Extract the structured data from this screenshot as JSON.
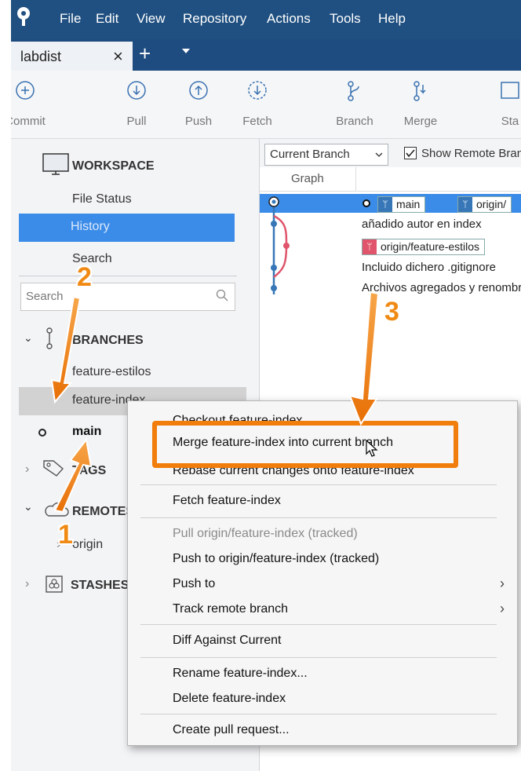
{
  "menubar": {
    "items": [
      "File",
      "Edit",
      "View",
      "Repository",
      "Actions",
      "Tools",
      "Help"
    ]
  },
  "tabs": {
    "active_label": "labdist",
    "close_glyph": "×",
    "add_glyph": "+"
  },
  "toolbar": {
    "commit": "Commit",
    "pull": "Pull",
    "push": "Push",
    "fetch": "Fetch",
    "branch": "Branch",
    "merge": "Merge",
    "stash": "Sta"
  },
  "sidebar": {
    "workspace_title": "WORKSPACE",
    "file_status": "File Status",
    "history": "History",
    "search_item": "Search",
    "search_placeholder": "Search",
    "branches_title": "BRANCHES",
    "branch_feature_estilos": "feature-estilos",
    "branch_feature_index": "feature-index",
    "branch_main": "main",
    "tags_title": "TAGS",
    "remotes_title": "REMOTES",
    "remote_origin": "origin",
    "stashes_title": "STASHES"
  },
  "main": {
    "branch_filter": "Current Branch",
    "show_remote_label": "Show Remote Branches",
    "show_remote_checked": true,
    "graph_header": "Graph",
    "rows": [
      {
        "pill_main": "main",
        "pill_origin": "origin/"
      },
      {
        "text": "añadido autor en index"
      },
      {
        "pill_red": "origin/feature-estilos"
      },
      {
        "text": "Incluido dichero .gitignore"
      },
      {
        "text": "Archivos agregados y renombrados"
      }
    ]
  },
  "context_menu": {
    "checkout": "Checkout feature-index...",
    "merge": "Merge feature-index into current branch",
    "rebase": "Rebase current changes onto feature-index",
    "fetch": "Fetch feature-index",
    "pull": "Pull origin/feature-index (tracked)",
    "push_tracked": "Push to origin/feature-index (tracked)",
    "push_to": "Push to",
    "track_remote": "Track remote branch",
    "diff": "Diff Against Current",
    "rename": "Rename feature-index...",
    "delete": "Delete feature-index",
    "create_pr": "Create pull request..."
  },
  "annotations": {
    "step1": "1",
    "step2": "2",
    "step3": "3",
    "color": "#f07d0c"
  },
  "colors": {
    "menubar": "#205081",
    "selection": "#3b8ce8",
    "graph_blue": "#3777b8",
    "graph_pink": "#e0556b"
  }
}
